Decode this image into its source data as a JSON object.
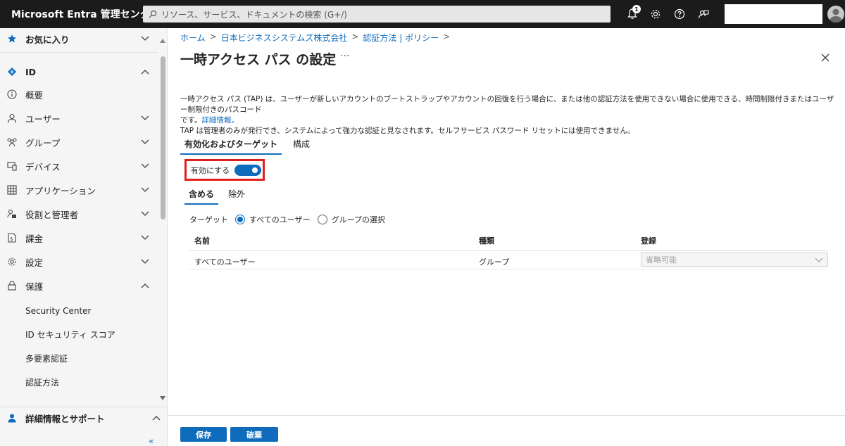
{
  "topbar": {
    "brand": "Microsoft Entra 管理センター",
    "search_placeholder": "リソース、サービス、ドキュメントの検索 (G+/)",
    "notification_count": "1",
    "icons": [
      "bell-icon",
      "gear-icon",
      "help-icon",
      "feedback-icon"
    ]
  },
  "sidebar": {
    "favorites": "お気に入り",
    "items": [
      {
        "label": "ID",
        "icon": "identity-icon"
      },
      {
        "label": "概要",
        "icon": "info-icon"
      },
      {
        "label": "ユーザー",
        "icon": "user-icon"
      },
      {
        "label": "グループ",
        "icon": "group-icon"
      },
      {
        "label": "デバイス",
        "icon": "device-icon"
      },
      {
        "label": "アプリケーション",
        "icon": "apps-icon"
      },
      {
        "label": "役割と管理者",
        "icon": "roles-icon"
      },
      {
        "label": "課金",
        "icon": "billing-icon"
      },
      {
        "label": "設定",
        "icon": "settings-icon"
      },
      {
        "label": "保護",
        "icon": "lock-icon"
      }
    ],
    "protection_sub": [
      "Security Center",
      "ID セキュリティ スコア",
      "多要素認証",
      "認証方法"
    ],
    "learn_support": "詳細情報とサポート",
    "collapse": "«"
  },
  "main": {
    "breadcrumb": [
      "ホーム",
      "日本ビジネスシステムズ株式会社",
      "認証方法 | ポリシー"
    ],
    "title": "一時アクセス パス の設定",
    "more": "···",
    "description_line1": "一時アクセス パス (TAP) は、ユーザーが新しいアカウントのブートストラップやアカウントの回復を行う場合に、または他の認証方法を使用できない場合に使用できる、時間制限付きまたはユーザー制限付きのパスコード",
    "description_line2_prefix": "です。",
    "description_link": "詳細情報。",
    "description_line3": "TAP は管理者のみが発行でき、システムによって強力な認証と見なされます。セルフサービス パスワード リセットには使用できません。",
    "tabs": [
      "有効化およびターゲット",
      "構成"
    ],
    "enable_label": "有効にする",
    "enable_state": true,
    "subtabs": [
      "含める",
      "除外"
    ],
    "target_label": "ターゲット",
    "radio_all": "すべてのユーザー",
    "radio_groups": "グループの選択",
    "table": {
      "headers": [
        "名前",
        "種類",
        "登録"
      ],
      "rows": [
        {
          "name": "すべてのユーザー",
          "type": "グループ",
          "registration": "省略可能"
        }
      ]
    },
    "save": "保存",
    "discard": "破棄"
  },
  "colors": {
    "accent": "#0f6cbd",
    "highlight": "#e0201c",
    "topbar": "#1b1b1b"
  }
}
